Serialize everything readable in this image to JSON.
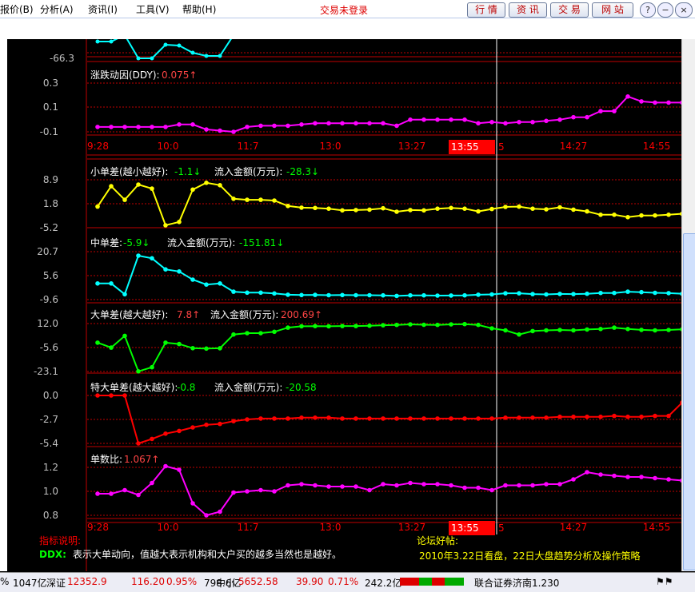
{
  "menu": {
    "items": [
      "报价(B)",
      "分析(A)",
      "资讯(I)",
      "工具(V)",
      "帮助(H)"
    ],
    "login_status": "交易未登录",
    "buttons": [
      "行 情",
      "资 讯",
      "交 易",
      "网 站"
    ],
    "window_controls": [
      "?",
      "−",
      "□",
      "×"
    ]
  },
  "top_panel": {
    "ytick": "-66.3"
  },
  "panel_ddy": {
    "title": "涨跌动因(DDY):",
    "value": "0.075↑",
    "yticks": [
      "0.3",
      "0.1",
      "-0.1"
    ]
  },
  "time_axis": {
    "labels": [
      "9:28",
      "10:0",
      "11:7",
      "13:0",
      "13:27",
      "14:27",
      "14:55"
    ],
    "cursor_label": "13:55",
    "cursor_tail": "5"
  },
  "panel_small": {
    "title": "小单差(越小越好):",
    "value": "-1.1↓",
    "flow_label": "流入金额(万元):",
    "flow_value": "-28.3↓",
    "yticks": [
      "8.9",
      "1.8",
      "-5.2"
    ]
  },
  "panel_mid": {
    "title": "中单差:",
    "value": "-5.9↓",
    "flow_label": "流入金额(万元):",
    "flow_value": "-151.81↓",
    "yticks": [
      "20.7",
      "5.6",
      "-9.6"
    ]
  },
  "panel_big": {
    "title": "大单差(越大越好):",
    "value": "7.8↑",
    "flow_label": "流入金额(万元):",
    "flow_value": "200.69↑",
    "yticks": [
      "12.0",
      "-5.6",
      "-23.1"
    ]
  },
  "panel_super": {
    "title": "特大单差(越大越好):",
    "value": "-0.8",
    "flow_label": "流入金额(万元):",
    "flow_value": "-20.58",
    "yticks": [
      "0.0",
      "-2.7",
      "-5.4"
    ]
  },
  "panel_ratio": {
    "title": "单数比:",
    "value": "1.067↑",
    "yticks": [
      "1.2",
      "1.0",
      "0.8"
    ]
  },
  "notes": {
    "label": "指标说明:",
    "ddx_key": "DDX:",
    "ddx_text": "表示大单动向，值越大表示机构和大户买的越多当然也是越好。",
    "forum_label": "论坛好帖:",
    "forum_text": "2010年3.22日看盘，22日大盘趋势分析及操作策略"
  },
  "status": {
    "s1": "%",
    "s2": "1047亿",
    "s3": "深证",
    "s4": "12352.9",
    "s5": "116.20",
    "s6": "0.95%",
    "s7": "798.6亿",
    "s8": "中小",
    "s9": "5652.58",
    "s10": "39.90",
    "s11": "0.71%",
    "s12": "242.2亿",
    "s13": "联合证券济南1.230"
  },
  "colors": {
    "ddy": "#ff00ff",
    "small": "#ffff00",
    "mid": "#00ffff",
    "big": "#00ff00",
    "super": "#ff0000",
    "ratio": "#ff00ff",
    "grid": "#c00000",
    "axis_text": "#c0c0c0"
  },
  "chart_data": [
    {
      "type": "line",
      "name": "DDY",
      "ylim": [
        -0.1,
        0.3
      ],
      "x_index": [
        0,
        1,
        2,
        3,
        4,
        5,
        6,
        7,
        8,
        9,
        10,
        11,
        12,
        13,
        14,
        15,
        16,
        17,
        18,
        19,
        20,
        21,
        22,
        23,
        24,
        25,
        26,
        27,
        28,
        29,
        30,
        31,
        32,
        33,
        34,
        35,
        36,
        37,
        38,
        39,
        40,
        41,
        42,
        43
      ],
      "values": [
        -0.06,
        -0.06,
        -0.06,
        -0.06,
        -0.06,
        -0.06,
        -0.04,
        -0.04,
        -0.08,
        -0.09,
        -0.1,
        -0.06,
        -0.05,
        -0.05,
        -0.05,
        -0.04,
        -0.03,
        -0.03,
        -0.03,
        -0.03,
        -0.03,
        -0.03,
        -0.05,
        0.0,
        0.0,
        0.0,
        0.0,
        0.0,
        -0.03,
        -0.02,
        -0.03,
        -0.02,
        -0.02,
        -0.01,
        0.0,
        0.02,
        0.02,
        0.07,
        0.07,
        0.19,
        0.15,
        0.14,
        0.14,
        0.14
      ]
    },
    {
      "type": "line",
      "name": "小单差",
      "ylim": [
        -5.2,
        8.9
      ],
      "values": [
        1.0,
        7.0,
        3.0,
        7.5,
        6.3,
        -4.5,
        -3.5,
        6.0,
        8.0,
        7.3,
        3.3,
        3.0,
        3.0,
        2.8,
        1.2,
        0.7,
        0.6,
        0.4,
        -0.1,
        0.0,
        0.1,
        0.5,
        -0.5,
        0.0,
        -0.1,
        0.4,
        0.6,
        0.4,
        -0.4,
        0.3,
        0.9,
        1.0,
        0.4,
        0.2,
        0.8,
        0.1,
        -0.4,
        -1.4,
        -1.4,
        -2.1,
        -1.6,
        -1.6,
        -1.4,
        -1.1
      ]
    },
    {
      "type": "line",
      "name": "中单差",
      "ylim": [
        -9.6,
        20.7
      ],
      "values": [
        0.6,
        0.6,
        -6.2,
        18.2,
        16.5,
        9.5,
        8.2,
        3.0,
        -0.1,
        0.6,
        -4.6,
        -5.2,
        -5.2,
        -5.7,
        -6.5,
        -6.7,
        -6.6,
        -6.8,
        -6.7,
        -6.8,
        -6.8,
        -6.9,
        -7.3,
        -6.9,
        -6.9,
        -7.1,
        -7.0,
        -6.9,
        -6.5,
        -6.3,
        -5.6,
        -5.6,
        -6.1,
        -6.3,
        -6.0,
        -6.1,
        -5.9,
        -5.4,
        -5.4,
        -4.6,
        -4.9,
        -5.3,
        -5.5,
        -5.9
      ]
    },
    {
      "type": "line",
      "name": "大单差",
      "ylim": [
        -23.1,
        12.0
      ],
      "values": [
        -2.0,
        -5.6,
        3.0,
        -23.0,
        -20.0,
        -2.0,
        -3.0,
        -6.0,
        -6.3,
        -6.1,
        4.0,
        5.0,
        5.0,
        6.0,
        9.0,
        10.0,
        10.1,
        10.0,
        10.2,
        10.2,
        10.4,
        10.8,
        11.0,
        11.4,
        11.1,
        11.0,
        11.4,
        11.6,
        11.0,
        8.5,
        7.0,
        4.0,
        6.5,
        7.0,
        7.3,
        7.0,
        7.7,
        8.0,
        9.0,
        8.0,
        7.4,
        7.0,
        7.3,
        7.8
      ]
    },
    {
      "type": "line",
      "name": "特大单差",
      "ylim": [
        -5.4,
        0.0
      ],
      "values": [
        0.0,
        0.0,
        0.0,
        -5.4,
        -4.9,
        -4.3,
        -4.0,
        -3.6,
        -3.3,
        -3.2,
        -2.9,
        -2.7,
        -2.6,
        -2.6,
        -2.6,
        -2.5,
        -2.5,
        -2.5,
        -2.6,
        -2.6,
        -2.6,
        -2.6,
        -2.6,
        -2.6,
        -2.6,
        -2.6,
        -2.6,
        -2.6,
        -2.6,
        -2.6,
        -2.5,
        -2.5,
        -2.5,
        -2.5,
        -2.4,
        -2.4,
        -2.4,
        -2.4,
        -2.3,
        -2.4,
        -2.4,
        -2.3,
        -2.3,
        -0.8
      ]
    },
    {
      "type": "line",
      "name": "单数比",
      "ylim": [
        0.8,
        1.2
      ],
      "values": [
        0.98,
        0.98,
        1.01,
        0.97,
        1.07,
        1.21,
        1.18,
        0.9,
        0.8,
        0.83,
        0.99,
        1.0,
        1.01,
        1.0,
        1.05,
        1.06,
        1.05,
        1.04,
        1.04,
        1.04,
        1.01,
        1.06,
        1.05,
        1.07,
        1.06,
        1.06,
        1.05,
        1.03,
        1.03,
        1.01,
        1.05,
        1.05,
        1.05,
        1.06,
        1.06,
        1.1,
        1.16,
        1.14,
        1.13,
        1.12,
        1.12,
        1.11,
        1.1,
        1.09
      ]
    }
  ]
}
